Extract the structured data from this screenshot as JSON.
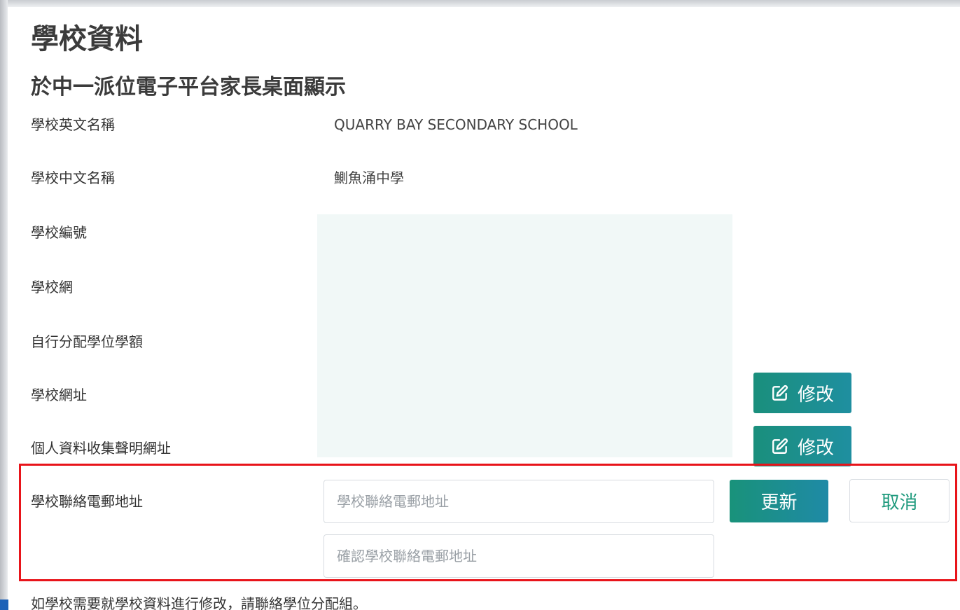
{
  "page": {
    "title": "學校資料",
    "subtitle": "於中一派位電子平台家長桌面顯示"
  },
  "fields": {
    "english_name": {
      "label": "學校英文名稱",
      "value": "QUARRY BAY SECONDARY SCHOOL"
    },
    "chinese_name": {
      "label": "學校中文名稱",
      "value": "鰂魚涌中學"
    },
    "school_code": {
      "label": "學校編號"
    },
    "school_net": {
      "label": "學校網"
    },
    "discretionary_places": {
      "label": "自行分配學位學額"
    },
    "website": {
      "label": "學校網址"
    },
    "pics_url": {
      "label": "個人資料收集聲明網址"
    }
  },
  "buttons": {
    "edit_label": "修改",
    "update_label": "更新",
    "cancel_label": "取消"
  },
  "email_section": {
    "label": "學校聯絡電郵地址",
    "email_placeholder": "學校聯絡電郵地址",
    "confirm_placeholder": "確認學校聯絡電郵地址"
  },
  "footer": {
    "note": "如學校需要就學校資料進行修改，請聯絡學位分配組。"
  },
  "icons": {
    "edit": "pencil-square-icon"
  },
  "colors": {
    "accent": "#1a8f7c",
    "highlight": "#e8141a",
    "redacted": "#f1f8f7"
  }
}
